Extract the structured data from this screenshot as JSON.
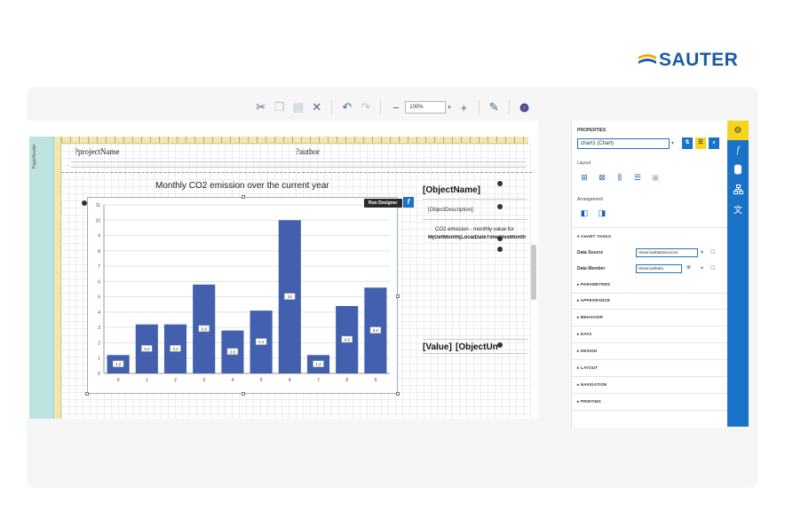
{
  "brand": {
    "name": "SAUTER",
    "color": "#1c5aa6"
  },
  "toolbar": {
    "buttons": [
      "cut-icon",
      "copy-icon",
      "paste-icon",
      "delete-icon",
      "undo-icon",
      "redo-icon",
      "zoom-out-icon",
      "zoom-in-icon",
      "validate-icon",
      "help-icon"
    ],
    "zoom_value": "100%"
  },
  "designer": {
    "band_label": "PageHeader",
    "project_name": "?projectName",
    "author": "?author",
    "chart_title": "Monthly CO2 emission over the current year",
    "run_designer": "Run Designer",
    "fx": "f",
    "object_name": "[ObjectName]",
    "object_description": "[ObjectDescription]",
    "co2_line1": "CO2 emission - monthly value for",
    "co2_line2": "M(GetMonth(LocalDateTimeThisMonth",
    "value": "[Value]",
    "object_unit": "[ObjectUn"
  },
  "chart_data": {
    "type": "bar",
    "categories": [
      "0",
      "1",
      "2",
      "3",
      "4",
      "5",
      "6",
      "7",
      "8",
      "9"
    ],
    "values": [
      1.2,
      3.2,
      3.2,
      5.8,
      2.8,
      4.1,
      10,
      1.2,
      4.4,
      5.6
    ],
    "data_labels": [
      "1.2",
      "3.2",
      "3.2",
      "5.8",
      "2.8",
      "4.1",
      "10",
      "1.2",
      "4.4",
      "5.6"
    ],
    "ylim": [
      0,
      11
    ],
    "yticks": [
      "0",
      "1",
      "2",
      "3",
      "4",
      "5",
      "6",
      "7",
      "8",
      "9",
      "10",
      "11"
    ],
    "grid": true,
    "color": "#4260ae"
  },
  "properties": {
    "title": "PROPERTIES",
    "selected": "chart1 (Chart)",
    "layout_label": "Layout",
    "arrangement_label": "Arrangement",
    "chart_tasks": "CHART TASKS",
    "data_source_label": "Data Source",
    "data_source_value": "HistoricalDataSource1",
    "data_member_label": "Data Member",
    "data_member_value": "HistoricalData",
    "parameters": "PARAMETERS",
    "categories": [
      "APPEARANCE",
      "BEHAVIOR",
      "DATA",
      "DESIGN",
      "LAYOUT",
      "NAVIGATION",
      "PRINTING"
    ]
  },
  "side_tabs": [
    "gear-icon",
    "function-icon",
    "database-icon",
    "tree-icon",
    "localization-icon"
  ]
}
